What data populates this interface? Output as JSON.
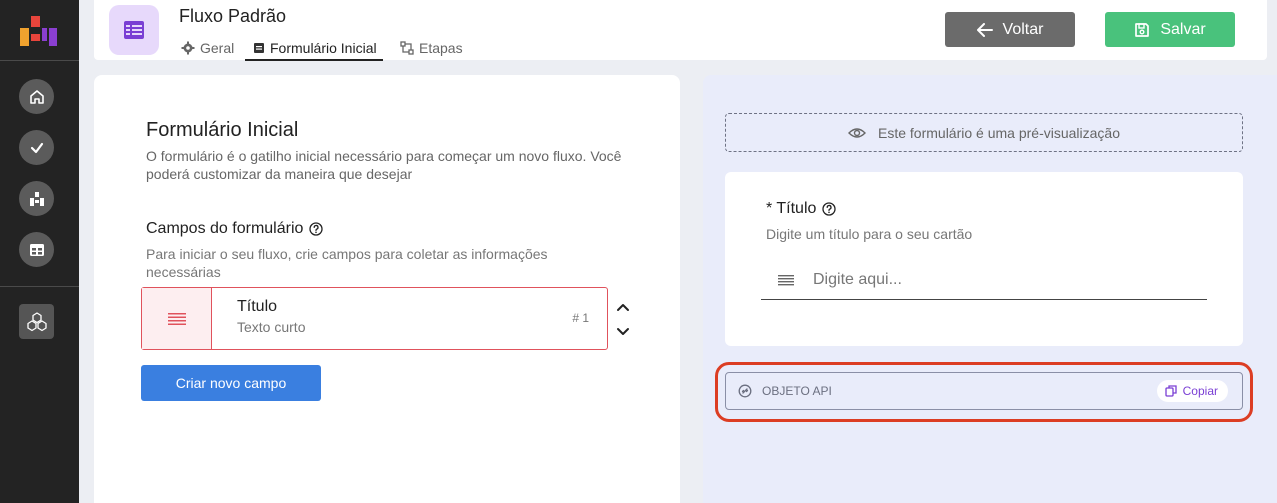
{
  "header": {
    "title": "Fluxo Padrão",
    "tabs": [
      {
        "label": "Geral",
        "icon": "gear-icon",
        "active": false
      },
      {
        "label": "Formulário Inicial",
        "icon": "document-icon",
        "active": true
      },
      {
        "label": "Etapas",
        "icon": "workflow-icon",
        "active": false
      }
    ],
    "back_label": "Voltar",
    "save_label": "Salvar"
  },
  "sidebar": {
    "items": [
      {
        "name": "home",
        "icon": "home-icon"
      },
      {
        "name": "tasks",
        "icon": "check-icon"
      },
      {
        "name": "flows",
        "icon": "flow-icon"
      },
      {
        "name": "tables",
        "icon": "table-icon"
      },
      {
        "name": "integrations",
        "icon": "cubes-icon"
      }
    ]
  },
  "form": {
    "title": "Formulário Inicial",
    "description": "O formulário é o gatilho inicial necessário para começar um novo fluxo. Você poderá customizar da maneira que desejar",
    "fields_title": "Campos do formulário",
    "fields_description": "Para iniciar o seu fluxo, crie campos para coletar as informações necessárias",
    "fields": [
      {
        "name": "Título",
        "type": "Texto curto",
        "number": "# 1"
      }
    ],
    "new_field_label": "Criar novo campo"
  },
  "preview": {
    "notice": "Este formulário é uma pré-visualização",
    "field_title": "* Título",
    "field_description": "Digite um título para o seu cartão",
    "input_placeholder": "Digite aqui...",
    "api_label": "OBJETO API",
    "copy_label": "Copiar"
  },
  "colors": {
    "sidebar": "#232323",
    "accent_purple": "#7a3fd4",
    "save_green": "#49c27c",
    "back_gray": "#6b6b6b",
    "primary_blue": "#3a7fe0",
    "field_red": "#e0525c",
    "highlight_red": "#dc3d23"
  }
}
